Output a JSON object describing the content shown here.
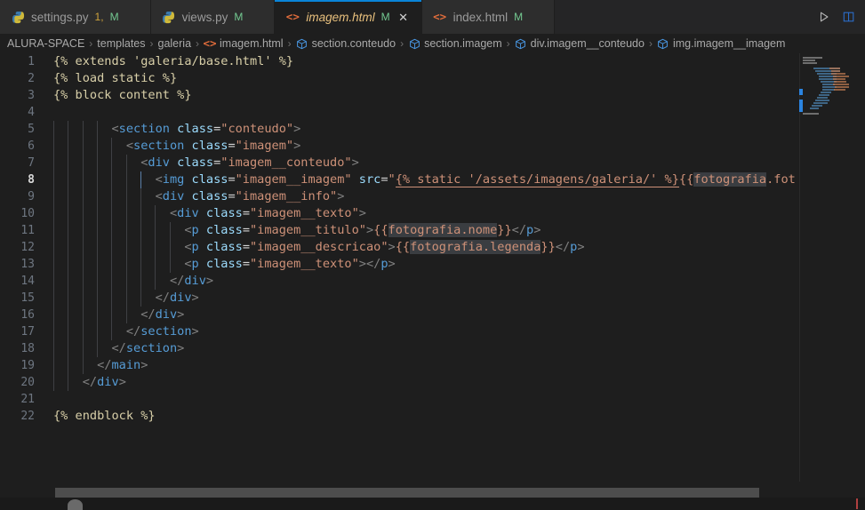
{
  "window": {
    "app": "Visual Studio Code",
    "theme_bg": "#1e1e1e",
    "accent": "#0a84d8"
  },
  "tabs": [
    {
      "label": "settings.py",
      "icon": "python-icon",
      "badges": [
        "1",
        "M"
      ],
      "active": false,
      "dirty": true
    },
    {
      "label": "views.py",
      "icon": "python-icon",
      "badges": [
        "M"
      ],
      "active": false,
      "dirty": true
    },
    {
      "label": "imagem.html",
      "icon": "html-icon",
      "badges": [
        "M"
      ],
      "active": true,
      "dirty": true,
      "close_glyph": "✕"
    },
    {
      "label": "index.html",
      "icon": "html-icon",
      "badges": [
        "M"
      ],
      "active": false,
      "dirty": true
    }
  ],
  "tab_actions": [
    {
      "name": "run-button",
      "glyph": "▷"
    },
    {
      "name": "split-editor-button",
      "glyph": "❐"
    }
  ],
  "breadcrumb": {
    "separator": "›",
    "items": [
      {
        "label": "ALURA-SPACE",
        "icon": ""
      },
      {
        "label": "templates",
        "icon": ""
      },
      {
        "label": "galeria",
        "icon": ""
      },
      {
        "label": "imagem.html",
        "icon": "html-icon"
      },
      {
        "label": "section.conteudo",
        "icon": "symbol-field-icon"
      },
      {
        "label": "section.imagem",
        "icon": "symbol-field-icon"
      },
      {
        "label": "div.imagem__conteudo",
        "icon": "symbol-field-icon"
      },
      {
        "label": "img.imagem__imagem",
        "icon": "symbol-field-icon"
      }
    ]
  },
  "editor": {
    "filename": "imagem.html",
    "language": "django-html",
    "active_line": 8,
    "line_numbers": [
      1,
      2,
      3,
      4,
      5,
      6,
      7,
      8,
      9,
      10,
      11,
      12,
      13,
      14,
      15,
      16,
      17,
      18,
      19,
      20,
      21,
      22
    ],
    "lines": [
      {
        "n": 1,
        "indents": [],
        "tokens": [
          {
            "t": "{% extends 'galeria/base.html' %}",
            "c": "t-tpl"
          }
        ]
      },
      {
        "n": 2,
        "indents": [],
        "tokens": [
          {
            "t": "{% load static %}",
            "c": "t-tpl"
          }
        ]
      },
      {
        "n": 3,
        "indents": [],
        "tokens": [
          {
            "t": "{% block content %}",
            "c": "t-tpl"
          }
        ]
      },
      {
        "n": 4,
        "indents": [],
        "tokens": []
      },
      {
        "n": 5,
        "indents": [
          0,
          1,
          2,
          3
        ],
        "tokens": [
          {
            "t": "        ",
            "c": ""
          },
          {
            "t": "<",
            "c": "t-punct"
          },
          {
            "t": "section",
            "c": "t-tag"
          },
          {
            "t": " ",
            "c": ""
          },
          {
            "t": "class",
            "c": "t-attr"
          },
          {
            "t": "=",
            "c": "t-eq"
          },
          {
            "t": "\"conteudo\"",
            "c": "t-val"
          },
          {
            "t": ">",
            "c": "t-punct"
          }
        ]
      },
      {
        "n": 6,
        "indents": [
          0,
          1,
          2,
          3,
          4
        ],
        "tokens": [
          {
            "t": "          ",
            "c": ""
          },
          {
            "t": "<",
            "c": "t-punct"
          },
          {
            "t": "section",
            "c": "t-tag"
          },
          {
            "t": " ",
            "c": ""
          },
          {
            "t": "class",
            "c": "t-attr"
          },
          {
            "t": "=",
            "c": "t-eq"
          },
          {
            "t": "\"imagem\"",
            "c": "t-val"
          },
          {
            "t": ">",
            "c": "t-punct"
          }
        ]
      },
      {
        "n": 7,
        "indents": [
          0,
          1,
          2,
          3,
          4,
          5
        ],
        "tokens": [
          {
            "t": "            ",
            "c": ""
          },
          {
            "t": "<",
            "c": "t-punct"
          },
          {
            "t": "div",
            "c": "t-tag"
          },
          {
            "t": " ",
            "c": ""
          },
          {
            "t": "class",
            "c": "t-attr"
          },
          {
            "t": "=",
            "c": "t-eq"
          },
          {
            "t": "\"imagem__conteudo\"",
            "c": "t-val"
          },
          {
            "t": ">",
            "c": "t-punct"
          }
        ]
      },
      {
        "n": 8,
        "indents": [
          0,
          1,
          2,
          3,
          4,
          5,
          6
        ],
        "tokens": [
          {
            "t": "              ",
            "c": ""
          },
          {
            "t": "<",
            "c": "t-punct"
          },
          {
            "t": "img",
            "c": "t-tag"
          },
          {
            "t": " ",
            "c": ""
          },
          {
            "t": "class",
            "c": "t-attr"
          },
          {
            "t": "=",
            "c": "t-eq"
          },
          {
            "t": "\"imagem__imagem\"",
            "c": "t-val"
          },
          {
            "t": " ",
            "c": ""
          },
          {
            "t": "src",
            "c": "t-attr"
          },
          {
            "t": "=",
            "c": "t-eq"
          },
          {
            "t": "\"",
            "c": "t-val"
          },
          {
            "t": "{% static '/assets/imagens/galeria/' %}",
            "c": "t-val underline-wave"
          },
          {
            "t": "{{",
            "c": "t-var"
          },
          {
            "t": "fotografia",
            "c": "t-var sel"
          },
          {
            "t": ".fot",
            "c": "t-var"
          }
        ]
      },
      {
        "n": 9,
        "indents": [
          0,
          1,
          2,
          3,
          4,
          5,
          6
        ],
        "tokens": [
          {
            "t": "              ",
            "c": ""
          },
          {
            "t": "<",
            "c": "t-punct"
          },
          {
            "t": "div",
            "c": "t-tag"
          },
          {
            "t": " ",
            "c": ""
          },
          {
            "t": "class",
            "c": "t-attr"
          },
          {
            "t": "=",
            "c": "t-eq"
          },
          {
            "t": "\"imagem__info\"",
            "c": "t-val"
          },
          {
            "t": ">",
            "c": "t-punct"
          }
        ]
      },
      {
        "n": 10,
        "indents": [
          0,
          1,
          2,
          3,
          4,
          5,
          6,
          7
        ],
        "tokens": [
          {
            "t": "                ",
            "c": ""
          },
          {
            "t": "<",
            "c": "t-punct"
          },
          {
            "t": "div",
            "c": "t-tag"
          },
          {
            "t": " ",
            "c": ""
          },
          {
            "t": "class",
            "c": "t-attr"
          },
          {
            "t": "=",
            "c": "t-eq"
          },
          {
            "t": "\"imagem__texto\"",
            "c": "t-val"
          },
          {
            "t": ">",
            "c": "t-punct"
          }
        ]
      },
      {
        "n": 11,
        "indents": [
          0,
          1,
          2,
          3,
          4,
          5,
          6,
          7,
          8
        ],
        "tokens": [
          {
            "t": "                  ",
            "c": ""
          },
          {
            "t": "<",
            "c": "t-punct"
          },
          {
            "t": "p",
            "c": "t-tag"
          },
          {
            "t": " ",
            "c": ""
          },
          {
            "t": "class",
            "c": "t-attr"
          },
          {
            "t": "=",
            "c": "t-eq"
          },
          {
            "t": "\"imagem__titulo\"",
            "c": "t-val"
          },
          {
            "t": ">",
            "c": "t-punct"
          },
          {
            "t": "{{",
            "c": "t-var"
          },
          {
            "t": "fotografia.nome",
            "c": "t-var sel"
          },
          {
            "t": "}}",
            "c": "t-var"
          },
          {
            "t": "</",
            "c": "t-punct"
          },
          {
            "t": "p",
            "c": "t-tag"
          },
          {
            "t": ">",
            "c": "t-punct"
          }
        ]
      },
      {
        "n": 12,
        "indents": [
          0,
          1,
          2,
          3,
          4,
          5,
          6,
          7,
          8
        ],
        "tokens": [
          {
            "t": "                  ",
            "c": ""
          },
          {
            "t": "<",
            "c": "t-punct"
          },
          {
            "t": "p",
            "c": "t-tag"
          },
          {
            "t": " ",
            "c": ""
          },
          {
            "t": "class",
            "c": "t-attr"
          },
          {
            "t": "=",
            "c": "t-eq"
          },
          {
            "t": "\"imagem__descricao\"",
            "c": "t-val"
          },
          {
            "t": ">",
            "c": "t-punct"
          },
          {
            "t": "{{",
            "c": "t-var"
          },
          {
            "t": "fotografia.legenda",
            "c": "t-var sel"
          },
          {
            "t": "}}",
            "c": "t-var"
          },
          {
            "t": "</",
            "c": "t-punct"
          },
          {
            "t": "p",
            "c": "t-tag"
          },
          {
            "t": ">",
            "c": "t-punct"
          }
        ]
      },
      {
        "n": 13,
        "indents": [
          0,
          1,
          2,
          3,
          4,
          5,
          6,
          7,
          8
        ],
        "tokens": [
          {
            "t": "                  ",
            "c": ""
          },
          {
            "t": "<",
            "c": "t-punct"
          },
          {
            "t": "p",
            "c": "t-tag"
          },
          {
            "t": " ",
            "c": ""
          },
          {
            "t": "class",
            "c": "t-attr"
          },
          {
            "t": "=",
            "c": "t-eq"
          },
          {
            "t": "\"imagem__texto\"",
            "c": "t-val"
          },
          {
            "t": ">",
            "c": "t-punct"
          },
          {
            "t": "</",
            "c": "t-punct"
          },
          {
            "t": "p",
            "c": "t-tag"
          },
          {
            "t": ">",
            "c": "t-punct"
          }
        ]
      },
      {
        "n": 14,
        "indents": [
          0,
          1,
          2,
          3,
          4,
          5,
          6,
          7
        ],
        "tokens": [
          {
            "t": "                ",
            "c": ""
          },
          {
            "t": "</",
            "c": "t-punct"
          },
          {
            "t": "div",
            "c": "t-tag"
          },
          {
            "t": ">",
            "c": "t-punct"
          }
        ]
      },
      {
        "n": 15,
        "indents": [
          0,
          1,
          2,
          3,
          4,
          5,
          6
        ],
        "tokens": [
          {
            "t": "              ",
            "c": ""
          },
          {
            "t": "</",
            "c": "t-punct"
          },
          {
            "t": "div",
            "c": "t-tag"
          },
          {
            "t": ">",
            "c": "t-punct"
          }
        ]
      },
      {
        "n": 16,
        "indents": [
          0,
          1,
          2,
          3,
          4,
          5
        ],
        "tokens": [
          {
            "t": "            ",
            "c": ""
          },
          {
            "t": "</",
            "c": "t-punct"
          },
          {
            "t": "div",
            "c": "t-tag"
          },
          {
            "t": ">",
            "c": "t-punct"
          }
        ]
      },
      {
        "n": 17,
        "indents": [
          0,
          1,
          2,
          3,
          4
        ],
        "tokens": [
          {
            "t": "          ",
            "c": ""
          },
          {
            "t": "</",
            "c": "t-punct"
          },
          {
            "t": "section",
            "c": "t-tag"
          },
          {
            "t": ">",
            "c": "t-punct"
          }
        ]
      },
      {
        "n": 18,
        "indents": [
          0,
          1,
          2,
          3
        ],
        "tokens": [
          {
            "t": "        ",
            "c": ""
          },
          {
            "t": "</",
            "c": "t-punct"
          },
          {
            "t": "section",
            "c": "t-tag"
          },
          {
            "t": ">",
            "c": "t-punct"
          }
        ]
      },
      {
        "n": 19,
        "indents": [
          0,
          1,
          2
        ],
        "tokens": [
          {
            "t": "      ",
            "c": ""
          },
          {
            "t": "</",
            "c": "t-punct"
          },
          {
            "t": "main",
            "c": "t-tag"
          },
          {
            "t": ">",
            "c": "t-punct"
          }
        ]
      },
      {
        "n": 20,
        "indents": [
          0,
          1
        ],
        "tokens": [
          {
            "t": "    ",
            "c": ""
          },
          {
            "t": "</",
            "c": "t-punct"
          },
          {
            "t": "div",
            "c": "t-tag"
          },
          {
            "t": ">",
            "c": "t-punct"
          }
        ]
      },
      {
        "n": 21,
        "indents": [],
        "tokens": []
      },
      {
        "n": 22,
        "indents": [],
        "tokens": [
          {
            "t": "{% endblock %}",
            "c": "t-tpl"
          }
        ]
      }
    ]
  },
  "minimap": {
    "selection_markers": 2,
    "color": "#2b84e0"
  },
  "scrollbar": {
    "horizontal_visible": true
  }
}
